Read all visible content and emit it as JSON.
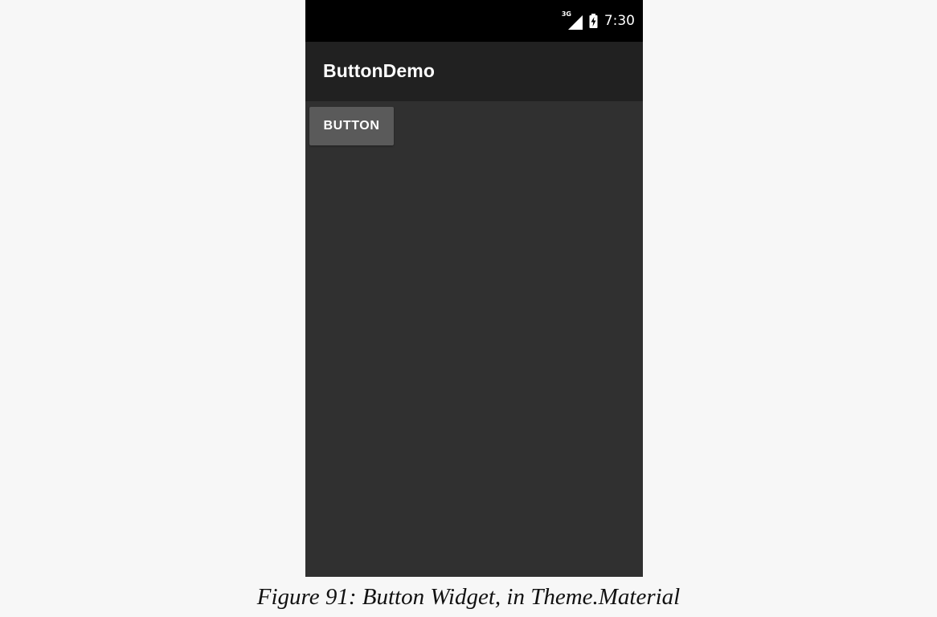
{
  "status_bar": {
    "network_type": "3G",
    "time": "7:30",
    "icons": [
      "signal-icon",
      "battery-charging-icon"
    ]
  },
  "app_bar": {
    "title": "ButtonDemo"
  },
  "content": {
    "button_label": "BUTTON"
  },
  "caption": "Figure 91: Button Widget, in Theme.Material",
  "colors": {
    "page_background": "#f7f7f7",
    "status_bar": "#000000",
    "app_bar": "#212121",
    "content_background": "#303030",
    "button_background": "#5a5a5a",
    "text_primary": "#ffffff"
  }
}
